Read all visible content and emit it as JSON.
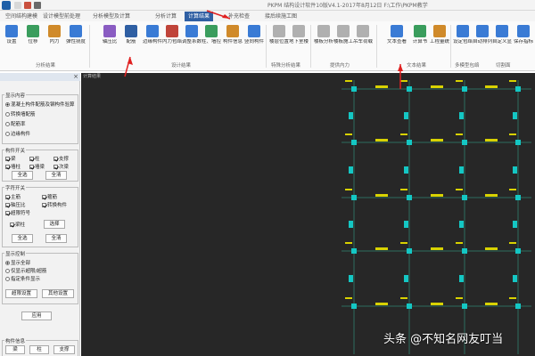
{
  "titlebar": {
    "title": "PKPM 结构设计软件10版V4.1-2017年8月12日 F:\\工作\\PKPM教学"
  },
  "tabs": [
    {
      "label": "空间结构建模",
      "active": false
    },
    {
      "label": "设计模型前处理",
      "active": false
    },
    {
      "label": "分析模型及计算",
      "active": false
    },
    {
      "label": "分析计算",
      "active": false
    },
    {
      "label": "计算结果",
      "active": true
    },
    {
      "label": "补充检查",
      "active": false
    },
    {
      "label": "接后续施工图",
      "active": false
    }
  ],
  "ribbon": {
    "buttons": [
      {
        "label": "设置",
        "icon": "settings-icon",
        "color": "#3a7bd5"
      },
      {
        "label": "位移",
        "icon": "displacement-icon",
        "color": "#3a9d5d"
      },
      {
        "label": "内力",
        "icon": "force-icon",
        "color": "#d08a2a"
      },
      {
        "label": "弹性挠度",
        "icon": "deflection-icon",
        "color": "#3a7bd5"
      },
      {
        "label": "轴压比",
        "icon": "axial-ratio-icon",
        "color": "#8a5cc2"
      },
      {
        "label": "配筋",
        "icon": "reinforcement-icon",
        "color": "#2f5fa3"
      },
      {
        "label": "边缘构件",
        "icon": "edge-member-icon",
        "color": "#3a7bd5"
      },
      {
        "label": "内力包络",
        "icon": "envelope-icon",
        "color": "#c0443a"
      },
      {
        "label": "调整系数",
        "icon": "factor-icon",
        "color": "#3a7bd5"
      },
      {
        "label": "柱、墙控制内力",
        "icon": "column-wall-icon",
        "color": "#3a9d5d"
      },
      {
        "label": "构件信息",
        "icon": "member-info-icon",
        "color": "#d08a2a"
      },
      {
        "label": "竖向构件排列统计",
        "icon": "vertical-member-icon",
        "color": "#3a7bd5"
      },
      {
        "label": "楼层位置",
        "icon": "floor-position-icon",
        "color": "#b0b0b0"
      },
      {
        "label": "地下室楼层",
        "icon": "basement-icon",
        "color": "#b0b0b0"
      },
      {
        "label": "楼板分析",
        "icon": "slab-icon",
        "color": "#b0b0b0"
      },
      {
        "label": "楼板施工图",
        "icon": "slab-drawing-icon",
        "color": "#b0b0b0"
      },
      {
        "label": "吊车荷载",
        "icon": "crane-icon",
        "color": "#b0b0b0"
      },
      {
        "label": "文本查看",
        "icon": "text-view-icon",
        "color": "#3a7bd5"
      },
      {
        "label": "计算书",
        "icon": "report-icon",
        "color": "#3a9d5d"
      },
      {
        "label": "工程量统计",
        "icon": "quantity-icon",
        "color": "#d08a2a"
      },
      {
        "label": "设定包络",
        "icon": "set-envelope-icon",
        "color": "#3a7bd5"
      },
      {
        "label": "自动排列",
        "icon": "auto-arrange-icon",
        "color": "#3a7bd5"
      },
      {
        "label": "自定义显示",
        "icon": "custom-display-icon",
        "color": "#3a7bd5"
      },
      {
        "label": "保存指标",
        "icon": "save-index-icon",
        "color": "#3a7bd5"
      },
      {
        "label": "工具",
        "icon": "tool-icon",
        "color": "#3a7bd5"
      }
    ],
    "groups": [
      {
        "label": "分析结果"
      },
      {
        "label": "设计结果"
      },
      {
        "label": "特殊分析结果"
      },
      {
        "label": "提供内力"
      },
      {
        "label": "文本结果"
      },
      {
        "label": "多模型包络"
      },
      {
        "label": "切割面"
      }
    ]
  },
  "panel": {
    "content_title": "显示内容",
    "content_options": [
      {
        "label": "混凝土构件配筋及钢构件验算",
        "selected": true
      },
      {
        "label": "转换墙配筋",
        "selected": false
      },
      {
        "label": "配筋率",
        "selected": false
      },
      {
        "label": "边缘构件",
        "selected": false
      }
    ],
    "member_title": "构件开关",
    "members": [
      {
        "label": "梁",
        "checked": true
      },
      {
        "label": "柱",
        "checked": true
      },
      {
        "label": "支撑",
        "checked": true
      },
      {
        "label": "墙柱",
        "checked": true
      },
      {
        "label": "墙梁",
        "checked": true
      },
      {
        "label": "次梁",
        "checked": true
      }
    ],
    "member_buttons": {
      "all": "全选",
      "none": "全清"
    },
    "text_title": "字符开关",
    "texts": [
      {
        "label": "主筋",
        "checked": true
      },
      {
        "label": "箍筋",
        "checked": true
      },
      {
        "label": "轴压比",
        "checked": true
      },
      {
        "label": "转换构件",
        "checked": true
      },
      {
        "label": "超限符号",
        "checked": true
      }
    ],
    "special_label": "梁柱",
    "special_button": "选择",
    "text_buttons": {
      "all": "全选",
      "none": "全清"
    },
    "mode_title": "显示控制",
    "modes": [
      {
        "label": "显示全部",
        "selected": true
      },
      {
        "label": "仅显示超限/超筋",
        "selected": false
      },
      {
        "label": "指定条件显示",
        "selected": false
      }
    ],
    "filter_button": "超限设置",
    "other_button": "其他设置",
    "apply_button": "应用",
    "info_title": "构件信息",
    "bottom_buttons": [
      "梁",
      "柱",
      "支撑"
    ]
  },
  "canvas": {
    "tab_label": "计算结果"
  },
  "colors": {
    "accent": "#2f5fa3",
    "canvas_bg": "#272727",
    "grid_line": "#2e6d5f",
    "member_label": "#d8d200",
    "column_mark": "#14c7c4",
    "annotation": "#e02020"
  },
  "watermark": "头条 @不知名网友叮当"
}
